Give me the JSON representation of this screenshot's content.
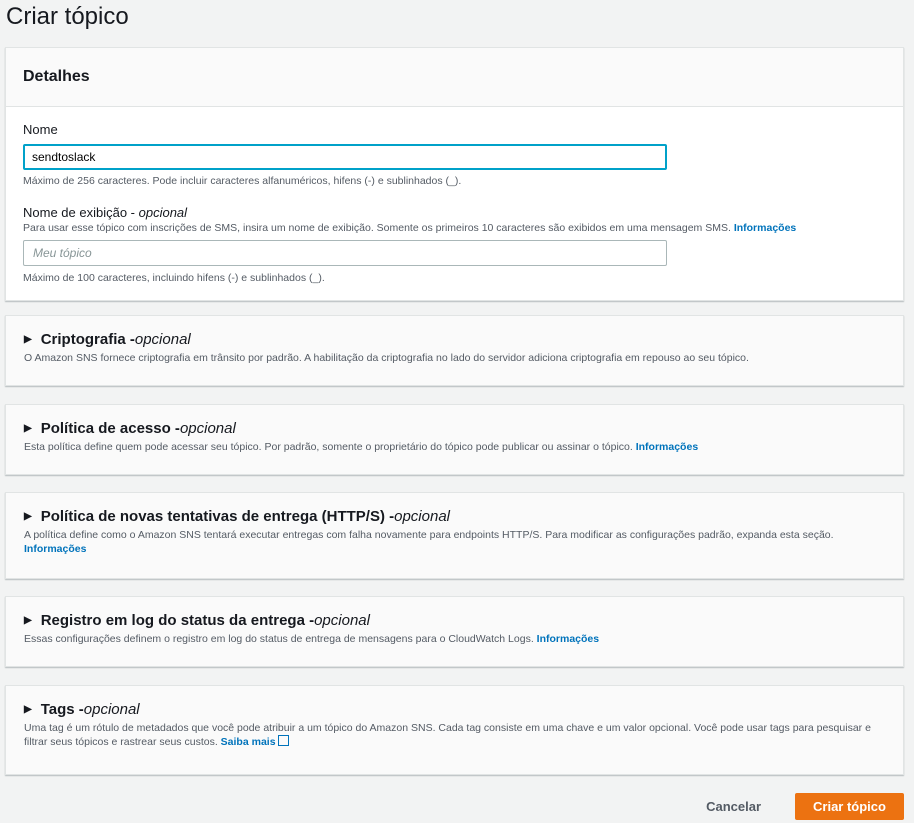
{
  "page_title": "Criar tópico",
  "details": {
    "title": "Detalhes",
    "name_label": "Nome",
    "name_value": "sendtoslack",
    "name_hint": "Máximo de 256 caracteres. Pode incluir caracteres alfanuméricos, hifens (-) e sublinhados (_).",
    "display_label": "Nome de exibição - ",
    "display_optional": "opcional",
    "display_desc": "Para usar esse tópico com inscrições de SMS, insira um nome de exibição. Somente os primeiros 10 caracteres são exibidos em uma mensagem SMS. ",
    "display_link": "Informações",
    "display_placeholder": "Meu tópico",
    "display_hint": "Máximo de 100 caracteres, incluindo hifens (-) e sublinhados (_)."
  },
  "sections": [
    {
      "title": "Criptografia - ",
      "optional": "opcional",
      "desc": "O Amazon SNS fornece criptografia em trânsito por padrão. A habilitação da criptografia no lado do servidor adiciona criptografia em repouso ao seu tópico.",
      "link": ""
    },
    {
      "title": "Política de acesso - ",
      "optional": "opcional",
      "desc": "Esta política define quem pode acessar seu tópico. Por padrão, somente o proprietário do tópico pode publicar ou assinar o tópico. ",
      "link": "Informações"
    },
    {
      "title": "Política de novas tentativas de entrega (HTTP/S) - ",
      "optional": "opcional",
      "desc": "A política define como o Amazon SNS tentará executar entregas com falha novamente para endpoints HTTP/S. Para modificar as configurações padrão, expanda esta seção. ",
      "link": "Informações"
    },
    {
      "title": "Registro em log do status da entrega - ",
      "optional": "opcional",
      "desc": "Essas configurações definem o registro em log do status de entrega de mensagens para o CloudWatch Logs. ",
      "link": "Informações"
    },
    {
      "title": "Tags - ",
      "optional": "opcional",
      "desc": "Uma tag é um rótulo de metadados que você pode atribuir a um tópico do Amazon SNS. Cada tag consiste em uma chave e um valor opcional. Você pode usar tags para pesquisar e filtrar seus tópicos e rastrear seus custos. ",
      "link": "Saiba mais"
    }
  ],
  "actions": {
    "cancel": "Cancelar",
    "create": "Criar tópico"
  }
}
